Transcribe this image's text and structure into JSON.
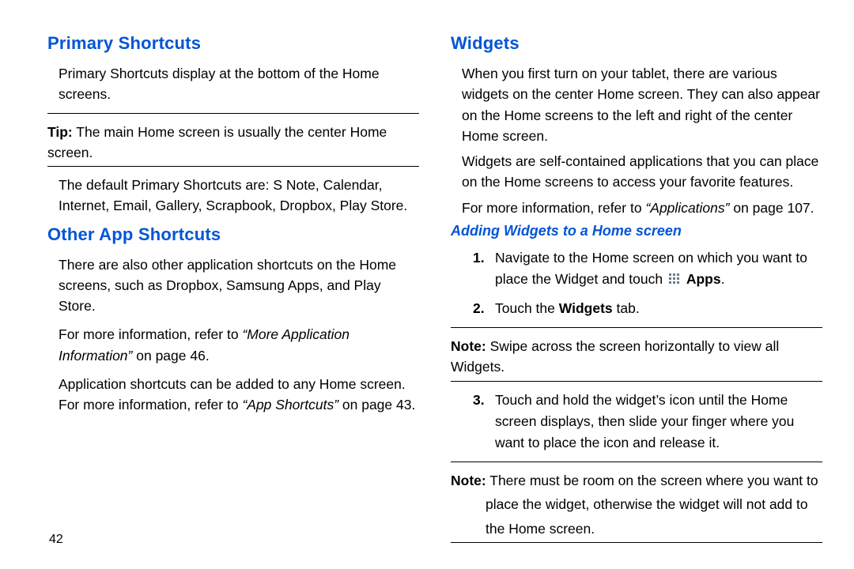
{
  "page_number": "42",
  "left": {
    "h1a": "Primary Shortcuts",
    "p1": "Primary Shortcuts display at the bottom of the Home screens.",
    "tip_label": "Tip:",
    "tip_text": " The main Home screen is usually the center Home screen.",
    "p2": "The default Primary Shortcuts are: S Note, Calendar, Internet, Email, Gallery, Scrapbook, Dropbox, Play Store.",
    "h1b": "Other App Shortcuts",
    "p3": "There are also other application shortcuts on the Home screens, such as Dropbox, Samsung Apps, and Play Store.",
    "p4a": "For more information, refer to ",
    "p4i": "“More Application Information”",
    "p4b": " on page 46.",
    "p5a": "Application shortcuts can be added to any Home screen. For more information, refer to ",
    "p5i": "“App Shortcuts”",
    "p5b": " on page 43."
  },
  "right": {
    "h1": "Widgets",
    "p1": "When you first turn on your tablet, there are various widgets on the center Home screen. They can also appear on the Home screens to the left and right of the center Home screen.",
    "p2": "Widgets are self-contained applications that you can place on the Home screens to access your favorite features.",
    "p3a": "For more information, refer to ",
    "p3i": "“Applications”",
    "p3b": " on page 107.",
    "h2": "Adding Widgets to a Home screen",
    "s1n": "1.",
    "s1a": "Navigate to the Home screen on which you want to place the Widget and touch ",
    "s1_apps": "Apps",
    "s1b": ".",
    "s2n": "2.",
    "s2a": "Touch the ",
    "s2_widgets": "Widgets",
    "s2b": " tab.",
    "note1_label": "Note:",
    "note1_text": " Swipe across the screen horizontally to view all Widgets.",
    "s3n": "3.",
    "s3": "Touch and hold the widget’s icon until the Home screen displays, then slide your finger where you want to place the icon and release it.",
    "note2_label": "Note:",
    "note2_text": " There must be room on the screen where you want to",
    "note2_cont1": "place the widget, otherwise the widget will not add to",
    "note2_cont2": "the Home screen."
  }
}
